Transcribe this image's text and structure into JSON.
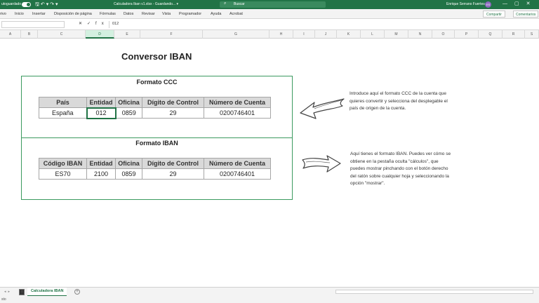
{
  "titlebar": {
    "autosave_label": "utoguardado",
    "filename": "Calculadora Iban v1.xlsx  -  Guardando...  ▾",
    "search_placeholder": "Buscar",
    "user_name": "Enrique Serrano Fuertes",
    "avatar_initials": "ES"
  },
  "ribbon": {
    "tabs": [
      "rivo",
      "Inicio",
      "Insertar",
      "Disposición de página",
      "Fórmulas",
      "Datos",
      "Revisar",
      "Vista",
      "Programador",
      "Ayuda",
      "Acrobat"
    ],
    "share_label": "Compartir",
    "comments_label": "Comentarios"
  },
  "formula_bar": {
    "name_box": "",
    "content": "012"
  },
  "columns": [
    "A",
    "B",
    "C",
    "D",
    "E",
    "F",
    "G",
    "H",
    "I",
    "J",
    "K",
    "L",
    "M",
    "N",
    "O",
    "P",
    "Q",
    "R",
    "S"
  ],
  "selected_column": "D",
  "sheet": {
    "title": "Conversor IBAN",
    "ccc": {
      "title": "Formato CCC",
      "headers": [
        "País",
        "Entidad",
        "Oficina",
        "Dígito de Control",
        "Número de Cuenta"
      ],
      "row": [
        "España",
        "012",
        "0859",
        "29",
        "0200746401"
      ]
    },
    "iban": {
      "title": "Formato IBAN",
      "headers": [
        "Código IBAN",
        "Entidad",
        "Oficina",
        "Dígito de Control",
        "Número de Cuenta"
      ],
      "row": [
        "ES70",
        "2100",
        "0859",
        "29",
        "0200746401"
      ]
    },
    "note1": "Introduce aquí el formato CCC de la cuenta que quieres convertir y selecciona del desplegable el país de origen de la cuenta.",
    "note2": "Aquí tienes el formato IBAN. Puedes ver cómo se obtiene en la pestaña oculta \"cálculos\", que puedes mostrar pinchando con el botón derecho del ratón sobre cualquier hoja y seleccionando la opción \"mostrar\"."
  },
  "sheet_tabs": {
    "active": "Calculadora IBAN"
  },
  "status": {
    "ready": "sto"
  },
  "colors": {
    "excel_green": "#217346",
    "box_border": "#3c9a5f",
    "header_fill": "#d9d9d9"
  }
}
